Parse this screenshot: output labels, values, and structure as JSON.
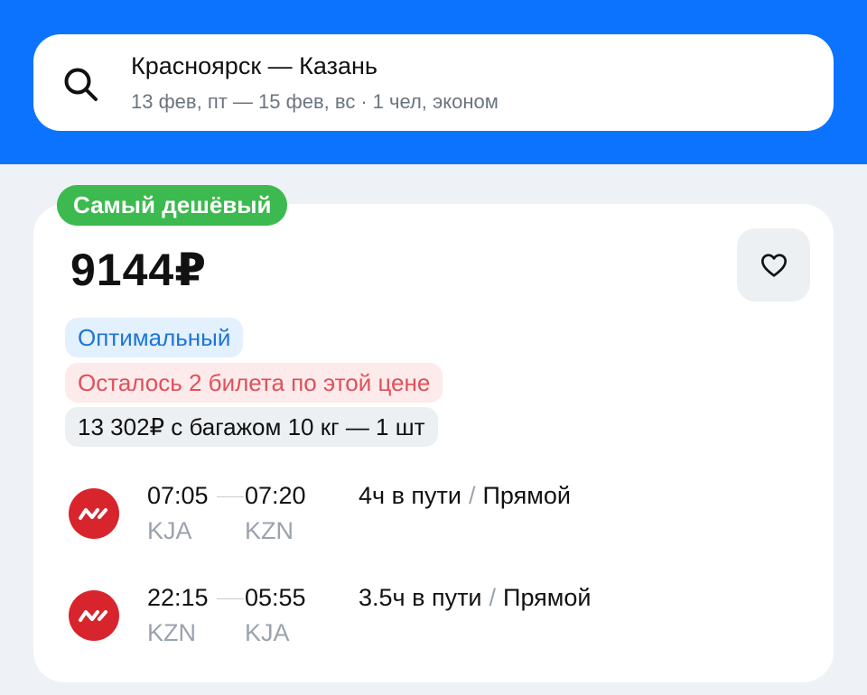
{
  "search": {
    "route": "Красноярск — Казань",
    "dates": "13 фев, пт — 15 фев, вс",
    "separator": "·",
    "passengers": "1 чел, эконом"
  },
  "offer": {
    "badge": "Самый дешёвый",
    "price": "9144₽",
    "tags": {
      "optimal": "Оптимальный",
      "tickets_left": "Осталось 2 билета по этой цене",
      "baggage": "13 302₽ с багажом 10 кг — 1 шт"
    }
  },
  "flights": [
    {
      "dep_time": "07:05",
      "arr_time": "07:20",
      "dep_code": "KJA",
      "arr_code": "KZN",
      "duration": "4ч в пути",
      "slash": "/",
      "stops": "Прямой"
    },
    {
      "dep_time": "22:15",
      "arr_time": "05:55",
      "dep_code": "KZN",
      "arr_code": "KJA",
      "duration": "3.5ч в пути",
      "slash": "/",
      "stops": "Прямой"
    }
  ],
  "colors": {
    "header_blue": "#0c73fe",
    "badge_green": "#3cb94f",
    "optimal_blue": "#1d75d8",
    "warning_red": "#e0505a",
    "airline_red": "#d8242c"
  },
  "icons": {
    "search": "search-icon",
    "favorite": "heart-icon",
    "airline": "airline-logo"
  }
}
